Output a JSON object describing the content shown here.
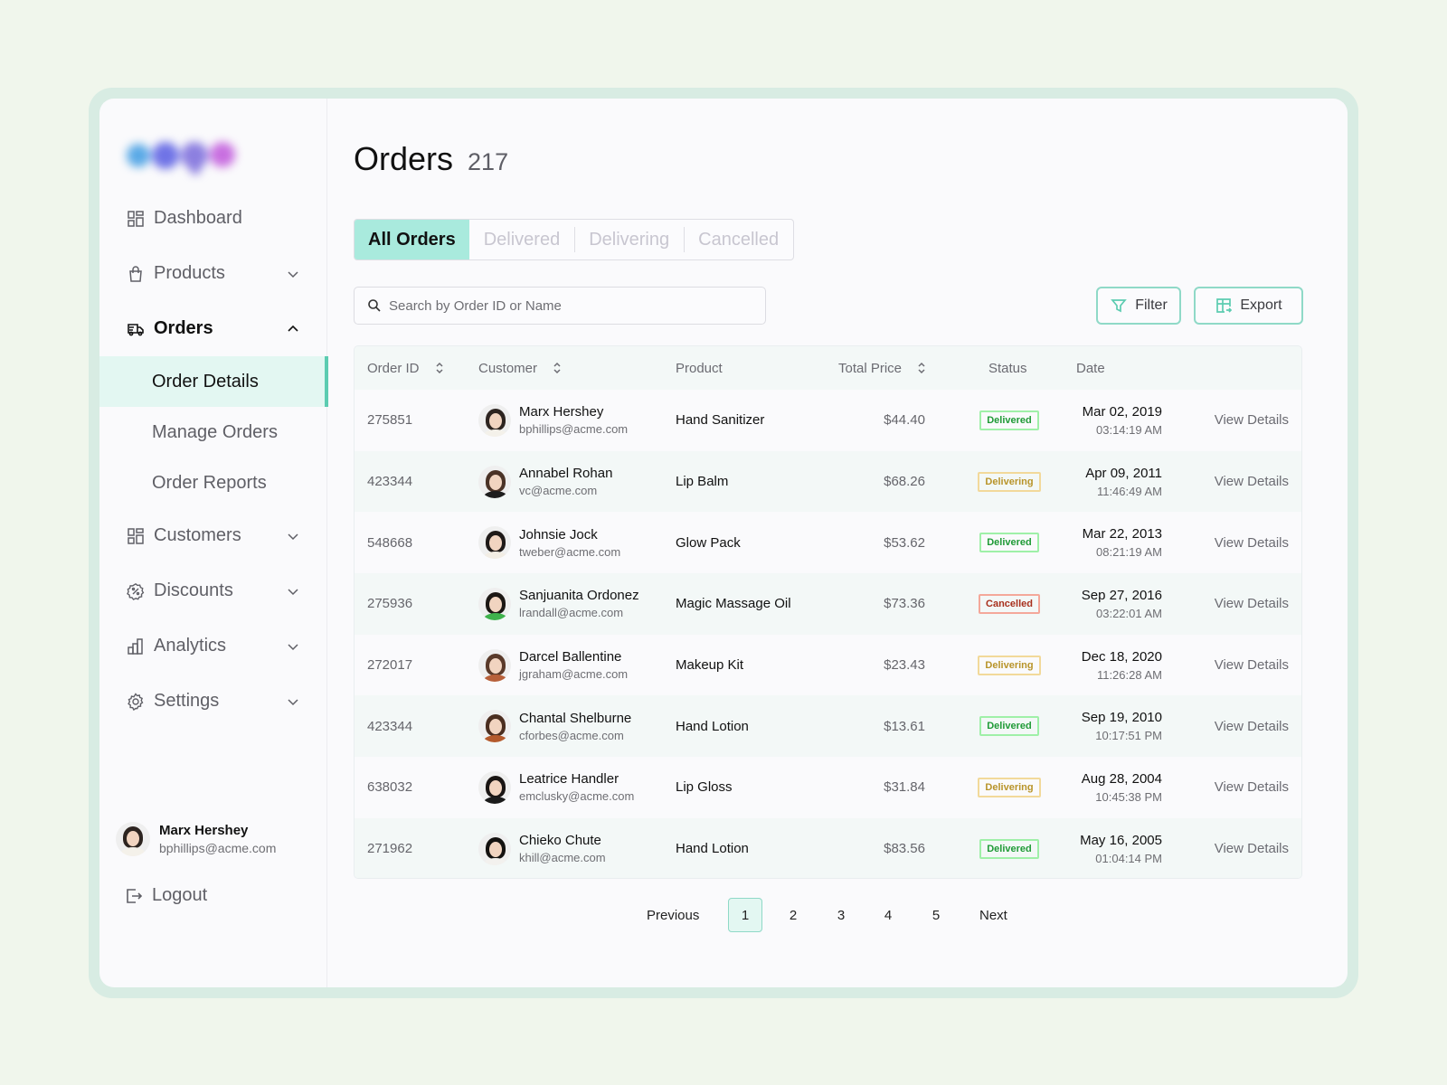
{
  "app": {
    "logo_text": "Logo",
    "colors": {
      "accent": "#5cccb1",
      "accent_light": "#a9eadd",
      "page_bg": "#f0f6ec",
      "frame": "#d8ece3",
      "delivered": "#1f9a36",
      "delivering": "#b8942a",
      "cancelled": "#a8301d"
    }
  },
  "sidebar": {
    "items": [
      {
        "label": "Dashboard",
        "icon": "dashboard-icon",
        "expandable": false
      },
      {
        "label": "Products",
        "icon": "shopping-bag-icon",
        "expandable": true,
        "expanded": false
      },
      {
        "label": "Orders",
        "icon": "truck-icon",
        "expandable": true,
        "expanded": true,
        "active": true,
        "children": [
          {
            "label": "Order Details",
            "active": true
          },
          {
            "label": "Manage Orders"
          },
          {
            "label": "Order Reports"
          }
        ]
      },
      {
        "label": "Customers",
        "icon": "grid-icon",
        "expandable": true,
        "expanded": false
      },
      {
        "label": "Discounts",
        "icon": "discount-badge-icon",
        "expandable": true,
        "expanded": false
      },
      {
        "label": "Analytics",
        "icon": "bar-chart-icon",
        "expandable": true,
        "expanded": false
      },
      {
        "label": "Settings",
        "icon": "gear-icon",
        "expandable": true,
        "expanded": false
      }
    ],
    "user": {
      "name": "Marx Hershey",
      "email": "bphillips@acme.com"
    },
    "logout_label": "Logout"
  },
  "header": {
    "title": "Orders",
    "count": "217"
  },
  "tabs": [
    {
      "label": "All Orders",
      "active": true
    },
    {
      "label": "Delivered"
    },
    {
      "label": "Delivering"
    },
    {
      "label": "Cancelled"
    }
  ],
  "search": {
    "placeholder": "Search by Order ID or Name",
    "value": ""
  },
  "toolbar": {
    "filter_label": "Filter",
    "export_label": "Export"
  },
  "table": {
    "columns": [
      {
        "label": "Order ID",
        "sortable": true
      },
      {
        "label": "Customer",
        "sortable": true
      },
      {
        "label": "Product",
        "sortable": false
      },
      {
        "label": "Total Price",
        "sortable": true
      },
      {
        "label": "Status",
        "sortable": false
      },
      {
        "label": "Date",
        "sortable": false
      }
    ],
    "action_label": "View Details",
    "rows": [
      {
        "id": "275851",
        "name": "Marx Hershey",
        "email": "bphillips@acme.com",
        "product": "Hand Sanitizer",
        "price": "$44.40",
        "status": "Delivered",
        "date": "Mar 02, 2019",
        "time": "03:14:19 AM"
      },
      {
        "id": "423344",
        "name": "Annabel Rohan",
        "email": "vc@acme.com",
        "product": "Lip Balm",
        "price": "$68.26",
        "status": "Delivering",
        "date": "Apr 09, 2011",
        "time": "11:46:49 AM"
      },
      {
        "id": "548668",
        "name": "Johnsie Jock",
        "email": "tweber@acme.com",
        "product": "Glow Pack",
        "price": "$53.62",
        "status": "Delivered",
        "date": "Mar 22, 2013",
        "time": "08:21:19 AM"
      },
      {
        "id": "275936",
        "name": "Sanjuanita Ordonez",
        "email": "lrandall@acme.com",
        "product": "Magic Massage Oil",
        "price": "$73.36",
        "status": "Cancelled",
        "date": "Sep 27, 2016",
        "time": "03:22:01 AM"
      },
      {
        "id": "272017",
        "name": "Darcel Ballentine",
        "email": "jgraham@acme.com",
        "product": "Makeup Kit",
        "price": "$23.43",
        "status": "Delivering",
        "date": "Dec 18, 2020",
        "time": "11:26:28 AM"
      },
      {
        "id": "423344",
        "name": "Chantal Shelburne",
        "email": "cforbes@acme.com",
        "product": "Hand Lotion",
        "price": "$13.61",
        "status": "Delivered",
        "date": "Sep 19, 2010",
        "time": "10:17:51 PM"
      },
      {
        "id": "638032",
        "name": "Leatrice Handler",
        "email": "emclusky@acme.com",
        "product": "Lip Gloss",
        "price": "$31.84",
        "status": "Delivering",
        "date": "Aug 28, 2004",
        "time": "10:45:38  PM"
      },
      {
        "id": "271962",
        "name": "Chieko Chute",
        "email": "khill@acme.com",
        "product": "Hand Lotion",
        "price": "$83.56",
        "status": "Delivered",
        "date": "May 16, 2005",
        "time": "01:04:14 PM"
      }
    ]
  },
  "pagination": {
    "previous_label": "Previous",
    "next_label": "Next",
    "pages": [
      "1",
      "2",
      "3",
      "4",
      "5"
    ],
    "current": "1"
  }
}
